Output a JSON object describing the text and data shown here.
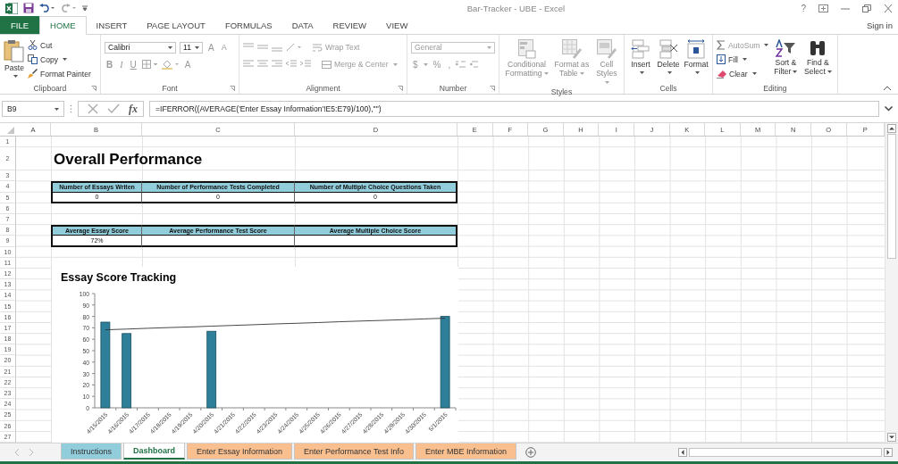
{
  "window": {
    "title": "Bar-Tracker - UBE - Excel",
    "help": "?"
  },
  "ribbon_tabs": [
    {
      "label": "FILE",
      "kind": "file",
      "selected": false
    },
    {
      "label": "HOME",
      "kind": "tab",
      "selected": true
    },
    {
      "label": "INSERT",
      "kind": "tab",
      "selected": false
    },
    {
      "label": "PAGE LAYOUT",
      "kind": "tab",
      "selected": false
    },
    {
      "label": "FORMULAS",
      "kind": "tab",
      "selected": false
    },
    {
      "label": "DATA",
      "kind": "tab",
      "selected": false
    },
    {
      "label": "REVIEW",
      "kind": "tab",
      "selected": false
    },
    {
      "label": "VIEW",
      "kind": "tab",
      "selected": false
    }
  ],
  "account": {
    "label": "Sign in"
  },
  "ribbon": {
    "clipboard": {
      "label": "Clipboard",
      "disabled": false,
      "paste": "Paste",
      "cut": "Cut",
      "copy": "Copy",
      "format_painter": "Format Painter"
    },
    "font": {
      "label": "Font",
      "disabled": true,
      "name": "Calibri",
      "size": "11",
      "grow": "A",
      "shrink": "A",
      "bold": "B",
      "italic": "I",
      "underline": "U",
      "font_color_button": "A"
    },
    "alignment": {
      "label": "Alignment",
      "disabled": true,
      "wrap": "Wrap Text",
      "merge": "Merge & Center"
    },
    "number": {
      "label": "Number",
      "disabled": true,
      "format": "General",
      "currency": "$",
      "percent": "%",
      "comma": ","
    },
    "styles": {
      "label": "Styles",
      "disabled": true,
      "buttons": [
        "Conditional Formatting",
        "Format as Table",
        "Cell Styles"
      ]
    },
    "cells": {
      "label": "Cells",
      "disabled": false,
      "buttons": [
        "Insert",
        "Delete",
        "Format"
      ]
    },
    "editing": {
      "label": "Editing",
      "disabled": false,
      "autosum": "AutoSum",
      "fill": "Fill",
      "clear": "Clear",
      "sort": "Sort & Filter",
      "find": "Find & Select"
    }
  },
  "formula_bar": {
    "name_box": "B9",
    "fx": "fx",
    "formula": "=IFERROR((AVERAGE('Enter Essay Information'!E5:E79)/100),\"\")"
  },
  "sheet": {
    "columns": [
      "A",
      "B",
      "C",
      "D",
      "E",
      "F",
      "G",
      "H",
      "I",
      "J",
      "K",
      "L",
      "M",
      "N",
      "O",
      "P"
    ],
    "rows": [
      "1",
      "2",
      "3",
      "4",
      "5",
      "6",
      "7",
      "8",
      "9",
      "10",
      "11",
      "12",
      "13",
      "14",
      "15",
      "16",
      "17",
      "18",
      "19",
      "20",
      "21",
      "22",
      "23",
      "24",
      "25",
      "26",
      "27"
    ],
    "title": "Overall Performance",
    "tables": [
      {
        "headers": [
          "Number of Essays Writen",
          "Number of Performance Tests Completed",
          "Number of Multiple Choice Questions Taken"
        ],
        "values": [
          "0",
          "0",
          "0"
        ]
      },
      {
        "headers": [
          "Average Essay Score",
          "Average Performance Test Score",
          "Average Multiple Choice Score"
        ],
        "values": [
          "72%"
        ]
      }
    ],
    "chart": {
      "chart_data": {
        "type": "bar",
        "title": "Essay Score Tracking",
        "categories": [
          "4/15/2015",
          "4/16/2015",
          "4/17/2015",
          "4/18/2015",
          "4/19/2015",
          "4/20/2015",
          "4/21/2015",
          "4/22/2015",
          "4/23/2015",
          "4/24/2015",
          "4/25/2015",
          "4/26/2015",
          "4/27/2015",
          "4/28/2015",
          "4/29/2015",
          "4/30/2015",
          "5/1/2015"
        ],
        "series": [
          {
            "color": "#2e7f99",
            "values": [
              75,
              65,
              null,
              null,
              null,
              67,
              null,
              null,
              null,
              null,
              null,
              null,
              null,
              null,
              null,
              null,
              80
            ]
          },
          {
            "type": "line",
            "color": "#333333",
            "values": [
              68.3,
              68.9,
              69.6,
              70.2,
              70.8,
              71.5,
              72.1,
              72.7,
              73.4,
              74.0,
              74.6,
              75.3,
              75.9,
              76.5,
              77.1,
              77.8,
              78.4
            ]
          }
        ],
        "ylim": [
          0,
          100
        ],
        "yticks": [
          0,
          10,
          20,
          30,
          40,
          50,
          60,
          70,
          80,
          90,
          100
        ]
      }
    }
  },
  "sheet_tabs": [
    {
      "label": "Instructions",
      "color": "#92cddc",
      "selected": false
    },
    {
      "label": "Dashboard",
      "selected": true
    },
    {
      "label": "Enter Essay Information",
      "color": "#fabf8f",
      "selected": false
    },
    {
      "label": "Enter Performance Test Info",
      "color": "#fabf8f",
      "selected": false
    },
    {
      "label": "Enter MBE Information",
      "color": "#fabf8f",
      "selected": false
    }
  ]
}
